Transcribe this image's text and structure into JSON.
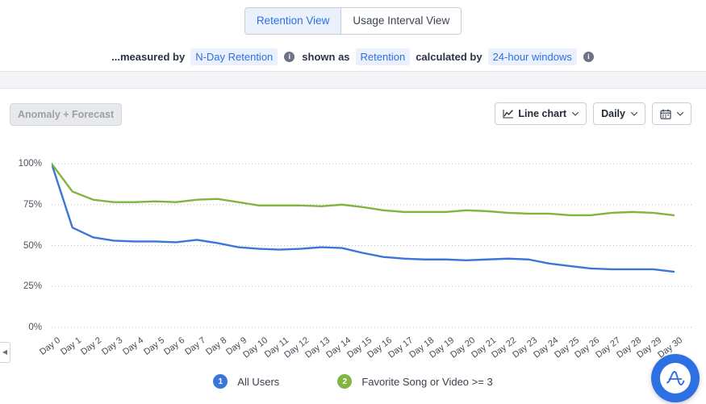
{
  "view_tabs": {
    "items": [
      {
        "label": "Retention View",
        "active": true
      },
      {
        "label": "Usage Interval View",
        "active": false
      }
    ]
  },
  "measure_bar": {
    "prefix": "...measured by",
    "metric": "N-Day Retention",
    "info_1": "i",
    "shown_as_label": "shown as",
    "shown_as_value": "Retention",
    "calculated_by_label": "calculated by",
    "calculated_by_value": "24-hour windows",
    "info_2": "i"
  },
  "toolbar": {
    "anomaly_label": "Anomaly + Forecast",
    "chart_type_label": "Line chart",
    "interval_label": "Daily",
    "caret": "⌄"
  },
  "legend": [
    {
      "index": "1",
      "label": "All Users",
      "color": "#3a76d8"
    },
    {
      "index": "2",
      "label": "Favorite Song or Video >= 3",
      "color": "#82b441"
    }
  ],
  "fab": {
    "name": "amplitude-logo",
    "letter": "A"
  },
  "collapse_handle": {
    "glyph": "◀"
  },
  "chart_data": {
    "type": "line",
    "title": "",
    "xlabel": "",
    "ylabel": "",
    "ylim": [
      0,
      100
    ],
    "yticks": [
      100,
      75,
      50,
      25,
      0
    ],
    "ytick_labels": [
      "100%",
      "75%",
      "50%",
      "25%",
      "0%"
    ],
    "grid": true,
    "legend_position": "bottom",
    "categories": [
      "Day 0",
      "Day 1",
      "Day 2",
      "Day 3",
      "Day 4",
      "Day 5",
      "Day 6",
      "Day 7",
      "Day 8",
      "Day 9",
      "Day 10",
      "Day 11",
      "Day 12",
      "Day 13",
      "Day 14",
      "Day 15",
      "Day 16",
      "Day 17",
      "Day 18",
      "Day 19",
      "Day 20",
      "Day 21",
      "Day 22",
      "Day 23",
      "Day 24",
      "Day 25",
      "Day 26",
      "Day 27",
      "Day 28",
      "Day 29",
      "Day 30"
    ],
    "series": [
      {
        "name": "All Users",
        "color": "#3a76d8",
        "values": [
          100,
          61,
          55,
          53,
          52.5,
          52.5,
          52,
          53.5,
          51.5,
          49,
          48,
          47.5,
          48,
          49,
          48.5,
          45.5,
          43,
          42,
          41.5,
          41.5,
          41,
          41.5,
          42,
          41.5,
          39,
          37.5,
          36,
          35.5,
          35.5,
          35.5,
          34
        ]
      },
      {
        "name": "Favorite Song or Video >= 3",
        "color": "#82b441",
        "values": [
          100,
          83,
          78,
          76.5,
          76.5,
          77,
          76.5,
          78,
          78.5,
          76.5,
          74.5,
          74.5,
          74.5,
          74,
          75,
          73.5,
          71.5,
          70.5,
          70.5,
          70.5,
          71.5,
          71,
          70,
          69.5,
          69.5,
          68.5,
          68.5,
          70,
          70.5,
          70,
          68.5
        ]
      }
    ]
  }
}
